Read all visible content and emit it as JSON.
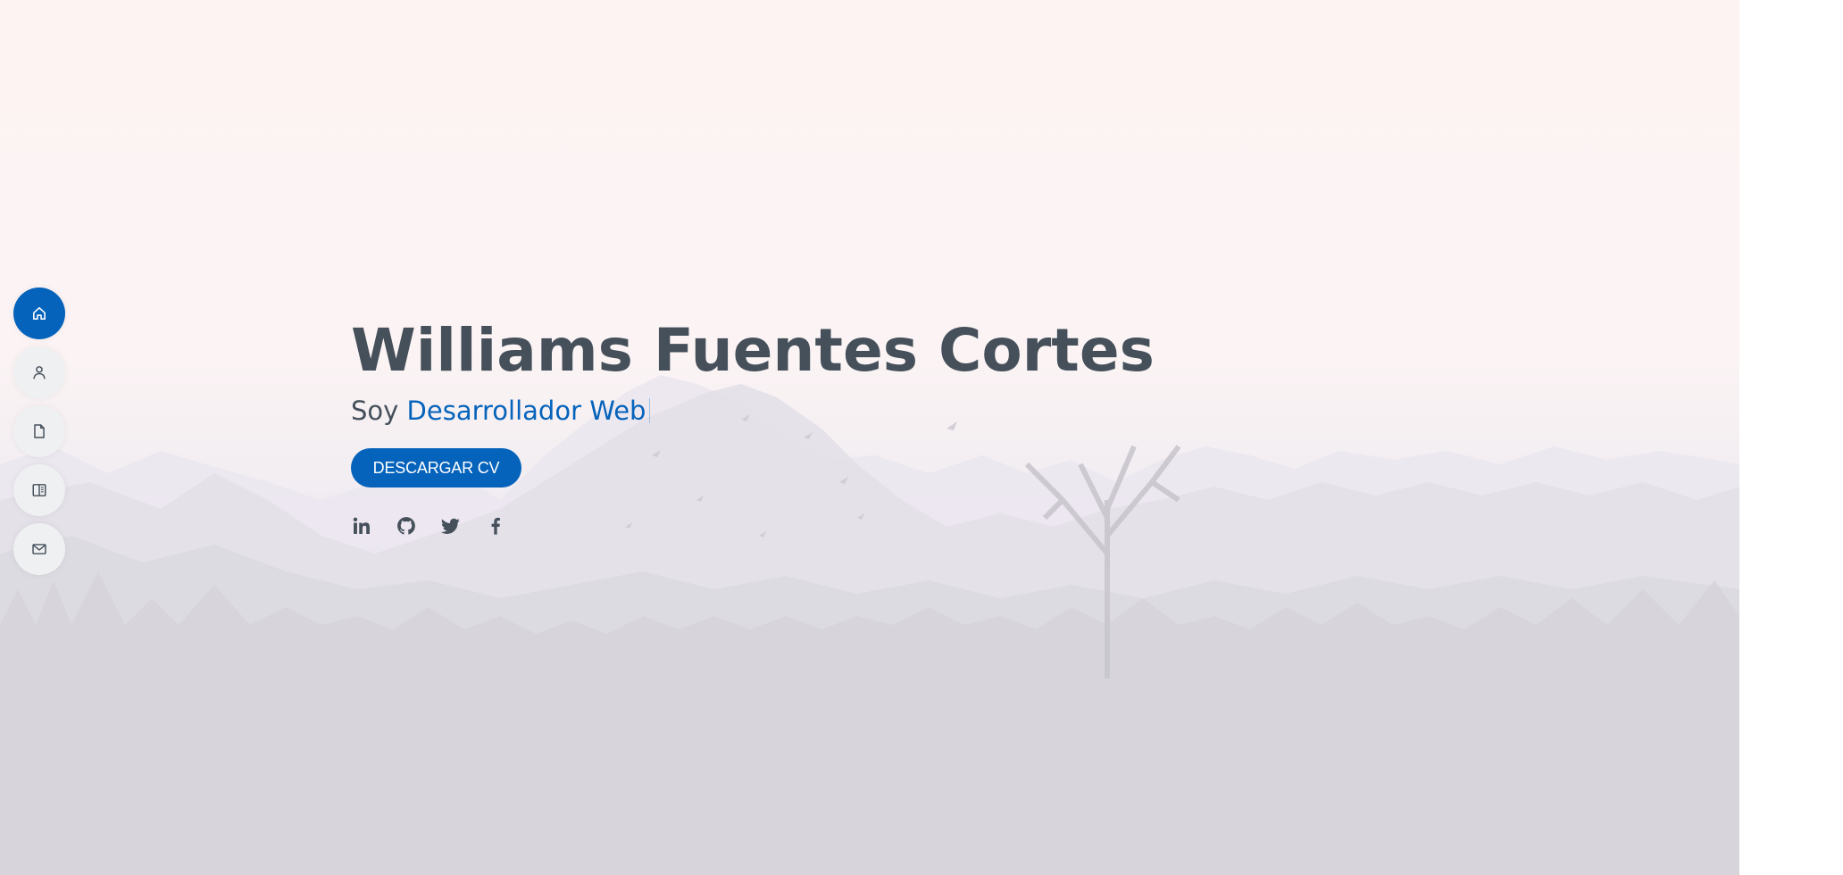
{
  "hero": {
    "name": "Williams Fuentes Cortes",
    "subtitle_prefix": "Soy",
    "subtitle_typed": "Desarrollador Web",
    "cv_button_label": "DESCARGAR CV"
  },
  "nav": {
    "items": [
      {
        "icon": "home-icon",
        "active": true
      },
      {
        "icon": "person-icon",
        "active": false
      },
      {
        "icon": "file-icon",
        "active": false
      },
      {
        "icon": "book-icon",
        "active": false
      },
      {
        "icon": "envelope-icon",
        "active": false
      }
    ]
  },
  "social": {
    "items": [
      {
        "icon": "linkedin-icon"
      },
      {
        "icon": "github-icon"
      },
      {
        "icon": "twitter-icon"
      },
      {
        "icon": "facebook-icon"
      }
    ]
  },
  "colors": {
    "accent": "#0563bb",
    "text": "#45505b",
    "nav_bg": "#eff0f2"
  }
}
